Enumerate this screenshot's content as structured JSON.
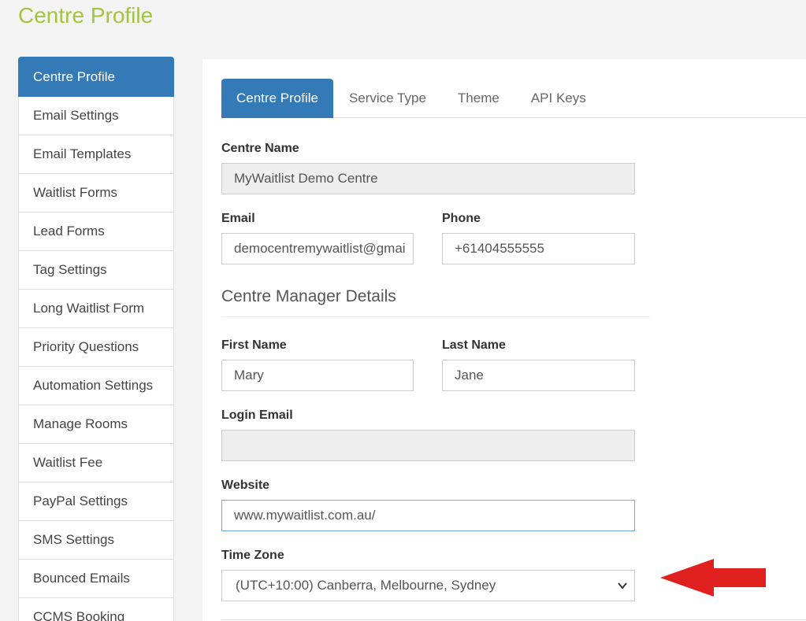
{
  "page_title": "Centre Profile",
  "sidebar": {
    "items": [
      {
        "label": "Centre Profile",
        "active": true
      },
      {
        "label": "Email Settings"
      },
      {
        "label": "Email Templates"
      },
      {
        "label": "Waitlist Forms"
      },
      {
        "label": "Lead Forms"
      },
      {
        "label": "Tag Settings"
      },
      {
        "label": "Long Waitlist Form"
      },
      {
        "label": "Priority Questions"
      },
      {
        "label": "Automation Settings"
      },
      {
        "label": "Manage Rooms"
      },
      {
        "label": "Waitlist Fee"
      },
      {
        "label": "PayPal Settings"
      },
      {
        "label": "SMS Settings"
      },
      {
        "label": "Bounced Emails"
      },
      {
        "label": "CCMS Booking"
      }
    ]
  },
  "tabs": [
    {
      "label": "Centre Profile",
      "active": true
    },
    {
      "label": "Service Type"
    },
    {
      "label": "Theme"
    },
    {
      "label": "API Keys"
    }
  ],
  "form": {
    "centre_name_label": "Centre Name",
    "centre_name_value": "MyWaitlist Demo Centre",
    "email_label": "Email",
    "email_value": "democentremywaitlist@gmai",
    "phone_label": "Phone",
    "phone_value": "+61404555555",
    "manager_section_title": "Centre Manager Details",
    "first_name_label": "First Name",
    "first_name_value": "Mary",
    "last_name_label": "Last Name",
    "last_name_value": "Jane",
    "login_email_label": "Login Email",
    "login_email_value": "",
    "website_label": "Website",
    "website_value": "www.mywaitlist.com.au/",
    "timezone_label": "Time Zone",
    "timezone_value": "(UTC+10:00) Canberra, Melbourne, Sydney"
  },
  "colors": {
    "title_green": "#a3c53e",
    "active_blue": "#337ab7",
    "arrow_red": "#e0201e"
  },
  "icons": {
    "select_chevron": "chevron-down-icon",
    "annotation": "red-arrow-left-icon"
  }
}
